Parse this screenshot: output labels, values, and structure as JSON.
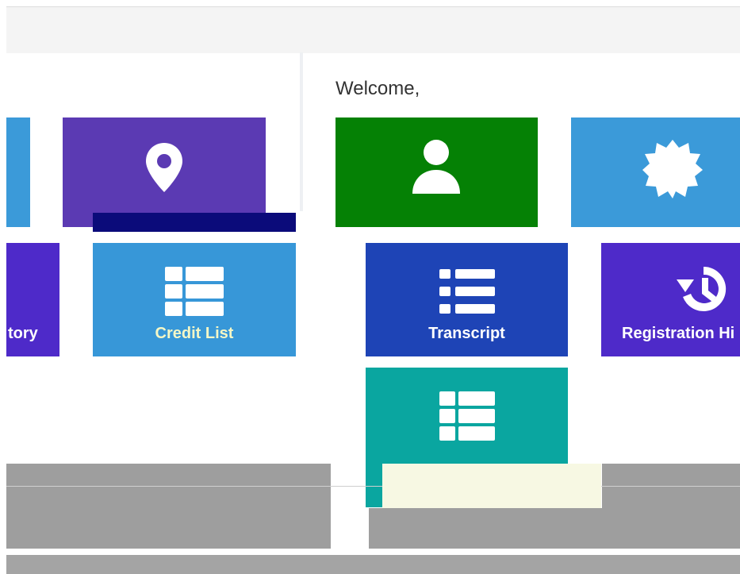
{
  "header": {
    "title": ""
  },
  "welcome_text": "Welcome,",
  "tiles": {
    "credit_list": "Credit List",
    "transcript": "Transcript",
    "registration_history": "Registration Hi",
    "history_partial": "tory"
  },
  "colors": {
    "purple": "#5b3ab3",
    "green": "#058105",
    "light_blue": "#3b9ad9",
    "credit_blue": "#3797d8",
    "transcript_blue": "#1e44b6",
    "violet": "#4e2ac9",
    "teal": "#0aa6a0",
    "gray": "#9e9e9e"
  },
  "icons": {
    "location": "map-pin-icon",
    "profile": "user-icon",
    "badge": "badge-icon",
    "list": "list-icon",
    "table": "table-icon",
    "history": "history-icon"
  }
}
